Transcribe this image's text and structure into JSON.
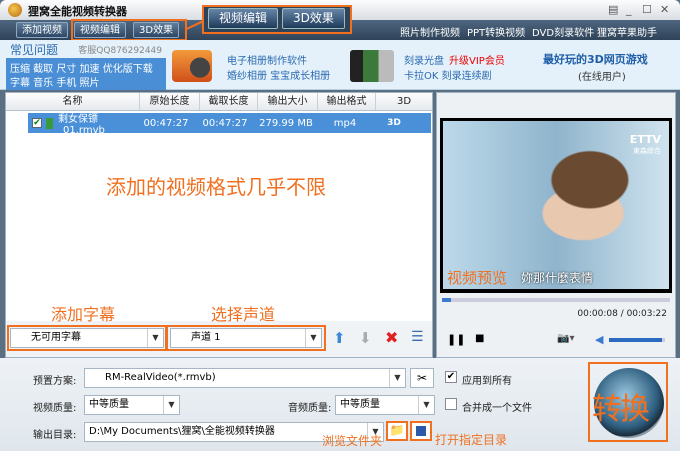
{
  "app": {
    "title": "狸窝全能视频转换器"
  },
  "toolbar": {
    "add_video": "添加视频",
    "edit_video": "视频编辑",
    "effect_3d": "3D效果",
    "callout_edit": "视频编辑",
    "callout_3d": "3D效果",
    "links": [
      "照片制作视频",
      "PPT转换视频",
      "DVD刻录软件",
      "狸窝苹果助手"
    ]
  },
  "banner": {
    "faq_title": "常见问题",
    "qq": "客服QQ876292449",
    "faq_line1": "压缩 截取 尺寸 加速 优化版下载",
    "faq_line2": "字幕 音乐 手机 照片",
    "ad1_line1": "电子相册制作软件",
    "ad1_line2": "婚纱相册 宝宝成长相册",
    "ad2_line1": "刻录光盘",
    "ad2_vip": "升级VIP会员",
    "ad2_line2": "卡拉OK 刻录连续剧",
    "ad3_line1": "最好玩的3D网页游戏",
    "ad3_line2": "(在线用户)"
  },
  "table": {
    "columns": [
      "名称",
      "原始长度",
      "截取长度",
      "输出大小",
      "输出格式",
      "3D"
    ],
    "rows": [
      {
        "name": "剩女保镖_01.rmvb",
        "orig": "00:47:27",
        "cut": "00:47:27",
        "size": "279.99 MB",
        "format": "mp4",
        "checked": true
      }
    ]
  },
  "annotations": {
    "formats": "添加的视频格式几乎不限",
    "subtitle": "添加字幕",
    "audio": "选择声道",
    "preview": "视频预览",
    "browse": "浏览文件夹",
    "open": "打开指定目录"
  },
  "controls": {
    "subtitle_value": "无可用字幕",
    "audio_value": "声道 1"
  },
  "player": {
    "time": "00:00:08 / 00:03:22",
    "progress": 0.04,
    "volume": 0.95,
    "overlay_logo": "ETTV",
    "overlay_channel": "東森綜合",
    "overlay_subtitle": "妳那什麼表情"
  },
  "settings": {
    "preset_label": "预置方案:",
    "preset_value": "RM-RealVideo(*.rmvb)",
    "video_q_label": "视频质量:",
    "video_q_value": "中等质量",
    "audio_q_label": "音频质量:",
    "audio_q_value": "中等质量",
    "output_label": "输出目录:",
    "output_value": "D:\\My Documents\\狸窝\\全能视频转换器",
    "apply_all": "应用到所有",
    "apply_all_checked": true,
    "merge": "合并成一个文件",
    "merge_checked": false,
    "convert": "转换"
  },
  "colors": {
    "accent": "#f07020",
    "selection": "#4a90d8",
    "toolbar": "#3b5269"
  }
}
